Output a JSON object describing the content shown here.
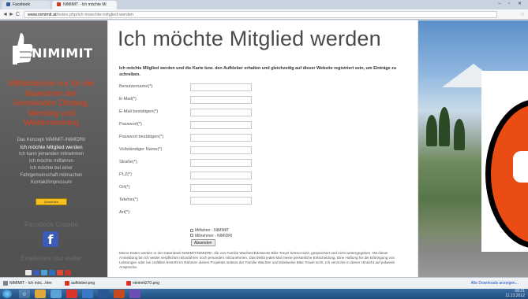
{
  "browser": {
    "tabs": [
      {
        "label": "Facebook",
        "active": false
      },
      {
        "label": "NIMIMIT - Ich möchte Mi",
        "active": true
      }
    ],
    "url_domain": "www.nimimit.at",
    "url_path": "/index.php/ich-moechte-mitglied-werden",
    "back": "◄",
    "forward": "►",
    "reload": "C",
    "star": "☆",
    "window_controls": "– ▫ ✕"
  },
  "sidebar": {
    "logo_text": "NIMIMIT",
    "tagline": "Mitfahrbörse nur für die Bewohner der Gemeinden Obsteig, Mieming und Wildermieming",
    "nav": [
      {
        "label": "Das Konzept NIMIMIT-/NIMIDRI!",
        "active": false
      },
      {
        "label": "Ich möchte Mitglied werden",
        "active": true
      },
      {
        "label": "Ich kann jemanden mitnehmen",
        "active": false
      },
      {
        "label": "Ich möchte mitfahren",
        "active": false
      },
      {
        "label": "Ich möchte bei einer",
        "active": false
      },
      {
        "label": "Fahrgemeinschaft mitmachen",
        "active": false
      },
      {
        "label": "Kontakt/Impressum",
        "active": false
      }
    ],
    "anmelden_label": "Anmelden",
    "facebook_title": "Facebook Gruppe",
    "facebook_glyph": "f",
    "share_title": "Empfehlen und weiter"
  },
  "content": {
    "title": "Ich möchte Mitglied werden",
    "intro": "Ich möchte Mitglied werden und die Karte bzw. den Aufkleber erhalten und gleichzeitig auf dieser Website registriert sein, um Einträge zu schreiben.",
    "fields": [
      {
        "label": "Benutzername(*)",
        "value": ""
      },
      {
        "label": "E-Mail(*)",
        "value": ""
      },
      {
        "label": "E-Mail bestätigen(*)",
        "value": ""
      },
      {
        "label": "Passwort(*)",
        "value": ""
      },
      {
        "label": "Passwort bestätigen(*)",
        "value": ""
      },
      {
        "label": "Vollständiger Name(*)",
        "value": ""
      },
      {
        "label": "Straße(*)",
        "value": ""
      },
      {
        "label": "PLZ(*)",
        "value": ""
      },
      {
        "label": "Ort(*)",
        "value": ""
      },
      {
        "label": "Telefon(*)",
        "value": ""
      }
    ],
    "art_label": "Art(*)",
    "art_options": [
      "Mitfahrer - NIMIMIT",
      "Mitnehmer - NIMIDRI"
    ],
    "submit_label": "Absenden",
    "footer": "Meine Daten werden in der Datenbank NIMIMIT/NIMIDRI!, die von Familie Wachter/Edelweiss Bike Travel betreut wird, gespeichert und nicht weitergegeben. Mit dieser Anmeldung bin ich weder verpflichtet mitzufahren noch jemanden mitzunehmen. Das bleibt jedes Mal meine persönliche Entscheidung. Eine Haftung für die Erbringung von Leistungen oder bei Unfällen besteht im Rahmen dieses Projektes seitens der Familie Wachter und Edelweiss Bike Travel nicht. Ich verzichte in dieser Hinsicht auf jedwede Ansprüche."
  },
  "downloads": {
    "items": [
      "NIMIMIT - Ich möc...htm",
      "aufkleber.png",
      "nimimit270.png"
    ],
    "show_all": "Alle Downloads anzeigen..."
  },
  "taskbar": {
    "time": "08:21",
    "date": "11.12.2012"
  },
  "colors": {
    "accent_orange": "#e63d12",
    "sidebar_bg": "#5e5e5e",
    "facebook_blue": "#3b5bb5"
  }
}
